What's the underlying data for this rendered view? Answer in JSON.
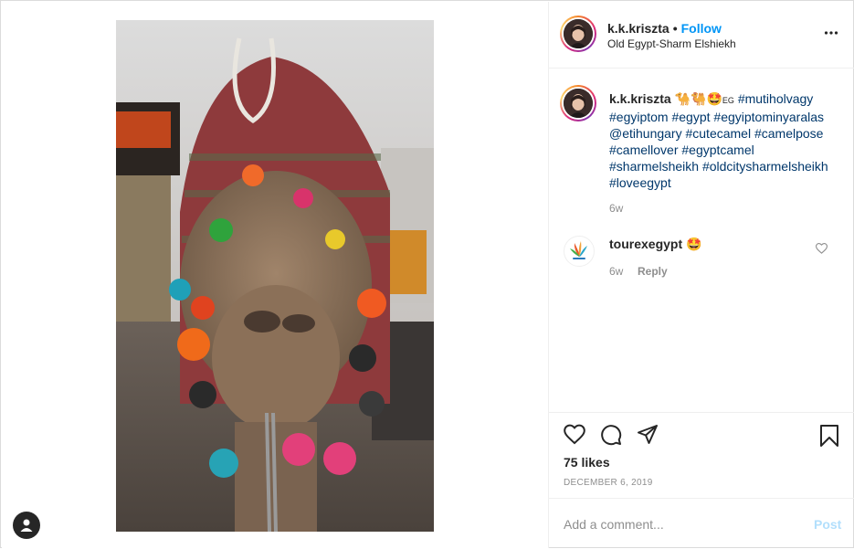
{
  "post": {
    "username": "k.k.kriszta",
    "separator": "•",
    "follow_label": "Follow",
    "location": "Old Egypt-Sharm Elshiekh",
    "photo_alt": "camel",
    "caption": {
      "username": "k.k.kriszta",
      "emojis": "🐪🐫🤩",
      "flag_text": "EG",
      "hashtags_line1": "#mutiholvagy",
      "hashtags_rest": "#egyiptom #egypt #egyiptominyaralas @etihungary #cutecamel #camelpose #camellover #egyptcamel #sharmelsheikh #oldcitysharmelsheikh #loveegypt"
    },
    "caption_time": "6w",
    "likes": "75 likes",
    "date": "DECEMBER 6, 2019"
  },
  "comments": [
    {
      "username": "tourexegypt",
      "text": "🤩",
      "time": "6w",
      "reply_label": "Reply"
    }
  ],
  "composer": {
    "placeholder": "Add a comment...",
    "post_label": "Post"
  },
  "icons": {
    "more": "more-options-icon",
    "like": "heart-icon",
    "comment": "comment-icon",
    "share": "share-icon",
    "save": "bookmark-icon"
  },
  "colors": {
    "accent": "#0095f6",
    "post_disabled": "#b2dffc",
    "hashtag": "#00376b",
    "muted": "#8e8e8e"
  }
}
